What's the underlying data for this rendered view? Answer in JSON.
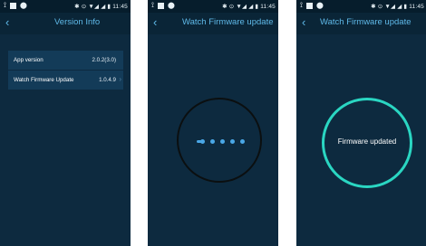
{
  "statusbar": {
    "time": "11:45",
    "icons_text": "✱ ⊙ ▼◢ ◢ ▮"
  },
  "screen1": {
    "back_icon": "‹",
    "title": "Version Info",
    "rows": [
      {
        "label": "App version",
        "value": "2.0.2(3.0)"
      },
      {
        "label": "Watch Firmware Update",
        "value": "1.0.4.9",
        "chevron": "›"
      }
    ]
  },
  "screen2": {
    "back_icon": "‹",
    "title": "Watch Firmware update"
  },
  "screen3": {
    "back_icon": "‹",
    "title": "Watch Firmware update",
    "message": "Firmware updated"
  },
  "colors": {
    "background": "#0d2a3f",
    "statusbar": "#061d2c",
    "accent": "#5fb9e8",
    "card": "#133b58",
    "ring_success": "#2ad6c2",
    "dot": "#4aa7e6"
  }
}
